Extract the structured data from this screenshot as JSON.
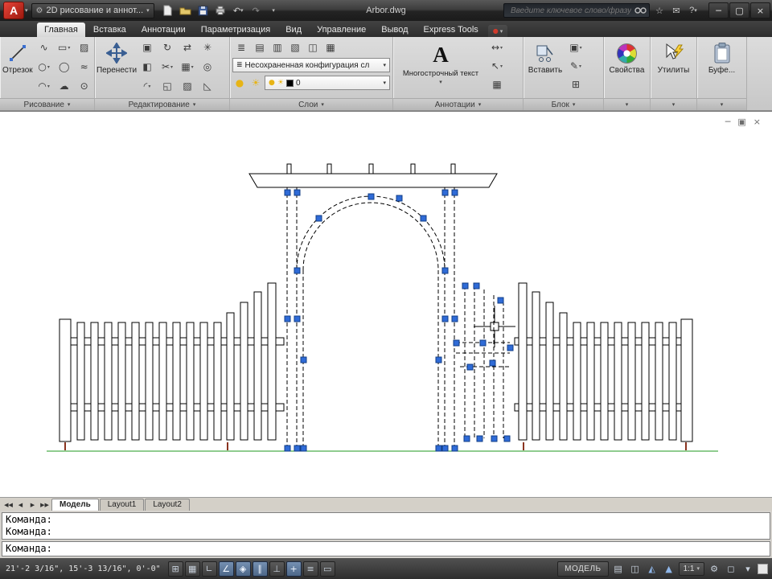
{
  "titlebar": {
    "logo_letter": "A",
    "workspace_label": "2D рисование и аннот...",
    "doc_title": "Arbor.dwg",
    "search_placeholder": "Введите ключевое слово/фразу"
  },
  "ribbon": {
    "tabs": [
      {
        "label": "Главная"
      },
      {
        "label": "Вставка"
      },
      {
        "label": "Аннотации"
      },
      {
        "label": "Параметризация"
      },
      {
        "label": "Вид"
      },
      {
        "label": "Управление"
      },
      {
        "label": "Вывод"
      },
      {
        "label": "Express Tools"
      }
    ],
    "panels": {
      "draw": {
        "title": "Рисование",
        "line_label": "Отрезок"
      },
      "modify": {
        "title": "Редактирование",
        "move_label": "Перенести"
      },
      "layers": {
        "title": "Слои",
        "state_combo": "Несохраненная конфигурация сл",
        "layer_name": "0"
      },
      "annotation": {
        "title": "Аннотации",
        "mtext_label": "Многострочный текст",
        "mtext_icon_letter": "A"
      },
      "block": {
        "title": "Блок",
        "insert_label": "Вставить"
      },
      "properties": {
        "title": "Свойства"
      },
      "utilities": {
        "title": "Утилиты"
      },
      "clipboard": {
        "title": "Буфе..."
      }
    }
  },
  "layout_tabs": {
    "model": "Модель",
    "layout1": "Layout1",
    "layout2": "Layout2"
  },
  "command": {
    "lines": [
      "Команда:",
      "Команда:",
      "Команда:"
    ]
  },
  "statusbar": {
    "coordinates": "21'-2 3/16\", 15'-3 13/16\",  0'-0\"",
    "model_label": "МОДЕЛЬ",
    "annotation_scale": "1:1",
    "toggles": [
      {
        "name": "snap",
        "glyph": "⊞"
      },
      {
        "name": "grid",
        "glyph": "▦"
      },
      {
        "name": "ortho",
        "glyph": "∟"
      },
      {
        "name": "polar",
        "glyph": "∠"
      },
      {
        "name": "osnap",
        "glyph": "◈"
      },
      {
        "name": "otrack",
        "glyph": "∥"
      },
      {
        "name": "ducs",
        "glyph": "⊥"
      },
      {
        "name": "dyn",
        "glyph": "+"
      },
      {
        "name": "lwt",
        "glyph": "≡"
      },
      {
        "name": "qp",
        "glyph": "▭"
      }
    ]
  },
  "icons": {
    "dropdown": "▾",
    "gear": "⚙",
    "undo": "↶",
    "redo": "↷",
    "star": "☆",
    "mail": "✉",
    "help": "?",
    "win_min": "─",
    "win_restore": "▢",
    "win_close": "×",
    "vp_min": "─",
    "vp_restore": "▣",
    "vp_close": "×",
    "red_dot": "●",
    "polyline": "∿",
    "circle": "○",
    "arc": "◠",
    "rect": "▭",
    "ellipse": "◯",
    "cloud": "☁",
    "hatch": "▨",
    "spline": "≈",
    "point": "⊙",
    "copy": "▣",
    "mirror": "◧",
    "fillet": "◜",
    "rotate": "↻",
    "trim": "✂",
    "scale": "◱",
    "stretch": "⇄",
    "array": "▦",
    "erase": "▨",
    "explode": "✳",
    "offset": "◎",
    "chamfer": "◺",
    "layer_props": "≣",
    "layer_a": "▤",
    "layer_b": "▥",
    "layer_c": "▧",
    "layer_d": "◫",
    "layer_e": "▦",
    "bulb": "●",
    "sun": "☀",
    "dim": "↔",
    "leader": "↖",
    "table_icon": "▦",
    "block_make": "▣",
    "attr_edit": "✎",
    "block_edit": "⊞",
    "qv_layouts": "▤",
    "qv_drawings": "◫",
    "ann_a": "◭",
    "ann_b": "▲",
    "sb_menu": "▾",
    "tray": "◻",
    "nav_first": "◀◀",
    "nav_prev": "◀",
    "nav_next": "▶",
    "nav_last": "▶▶"
  }
}
